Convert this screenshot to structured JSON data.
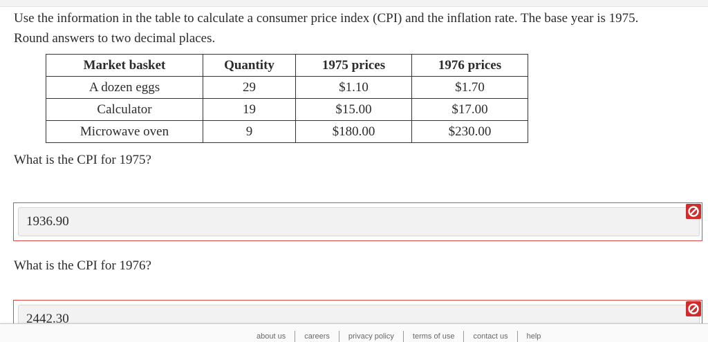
{
  "question": {
    "line1": "Use the information in the table to calculate a consumer price index (CPI) and the inflation rate. The base year is 1975.",
    "line2": "Round answers to two decimal places."
  },
  "table": {
    "headers": [
      "Market basket",
      "Quantity",
      "1975 prices",
      "1976 prices"
    ],
    "rows": [
      [
        "A dozen eggs",
        "29",
        "$1.10",
        "$1.70"
      ],
      [
        "Calculator",
        "19",
        "$15.00",
        "$17.00"
      ],
      [
        "Microwave oven",
        "9",
        "$180.00",
        "$230.00"
      ]
    ]
  },
  "answers": [
    {
      "prompt": "What is the CPI for 1975?",
      "value": "1936.90",
      "status": "incorrect",
      "status_icon": "prohibited-icon"
    },
    {
      "prompt": "What is the CPI for 1976?",
      "value": "2442.30",
      "status": "incorrect",
      "status_icon": "prohibited-icon"
    }
  ],
  "footer": {
    "links": [
      "about us",
      "careers",
      "privacy policy",
      "terms of use",
      "contact us",
      "help"
    ]
  },
  "colors": {
    "error": "#d22b2b",
    "border_error": "#e04848"
  }
}
